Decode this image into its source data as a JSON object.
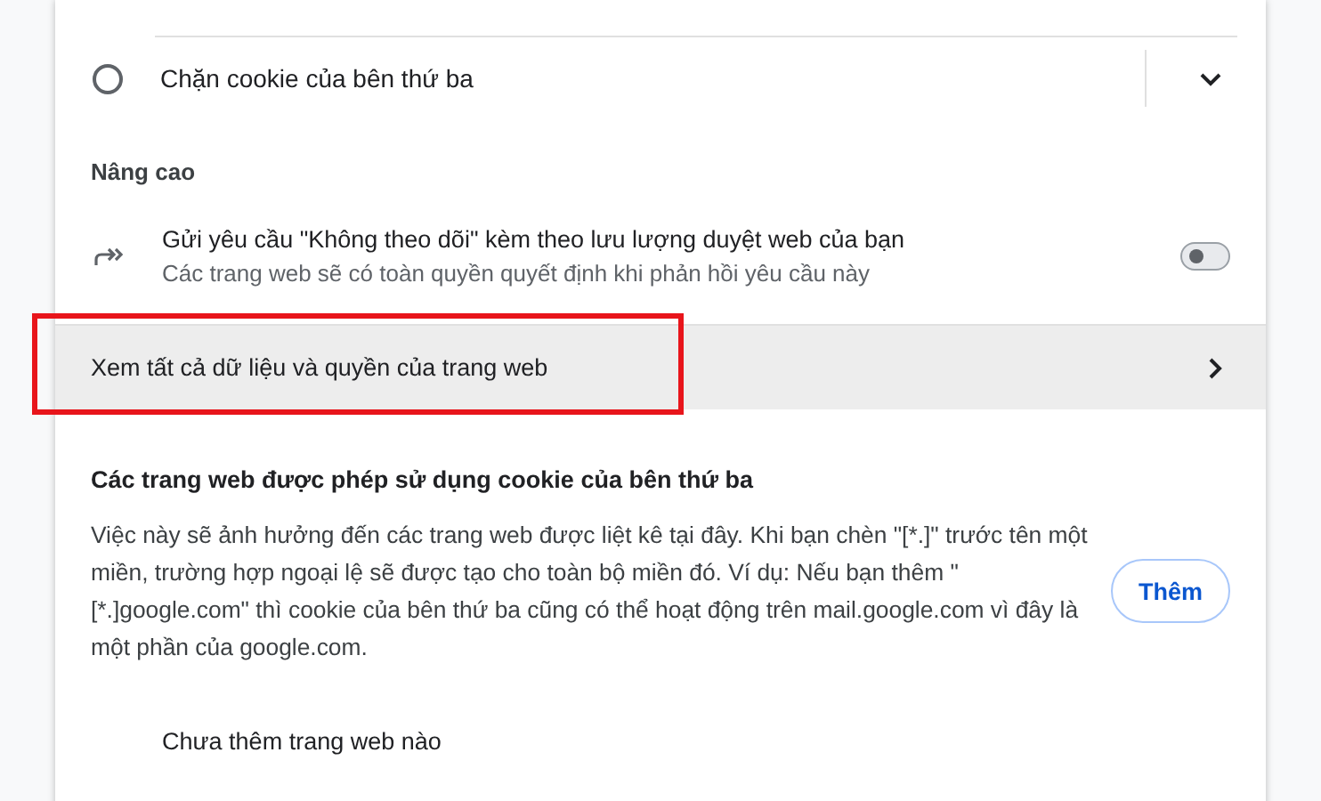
{
  "block_option": {
    "label": "Chặn cookie của bên thứ ba",
    "selected": false,
    "expanded": false
  },
  "advanced": {
    "heading": "Nâng cao",
    "do_not_track": {
      "title": "Gửi yêu cầu \"Không theo dõi\" kèm theo lưu lượng duyệt web của bạn",
      "subtitle": "Các trang web sẽ có toàn quyền quyết định khi phản hồi yêu cầu này",
      "on": false
    },
    "all_data_link": {
      "label": "Xem tất cả dữ liệu và quyền của trang web",
      "highlighted": true
    }
  },
  "allowed_sites": {
    "heading": "Các trang web được phép sử dụng cookie của bên thứ ba",
    "description": "Việc này sẽ ảnh hưởng đến các trang web được liệt kê tại đây. Khi bạn chèn \"[*.]\" trước tên một miền, trường hợp ngoại lệ sẽ được tạo cho toàn bộ miền đó. Ví dụ: Nếu bạn thêm \"[*.]google.com\" thì cookie của bên thứ ba cũng có thể hoạt động trên mail.google.com vì đây là một phần của google.com.",
    "add_button": "Thêm",
    "empty_text": "Chưa thêm trang web nào"
  }
}
